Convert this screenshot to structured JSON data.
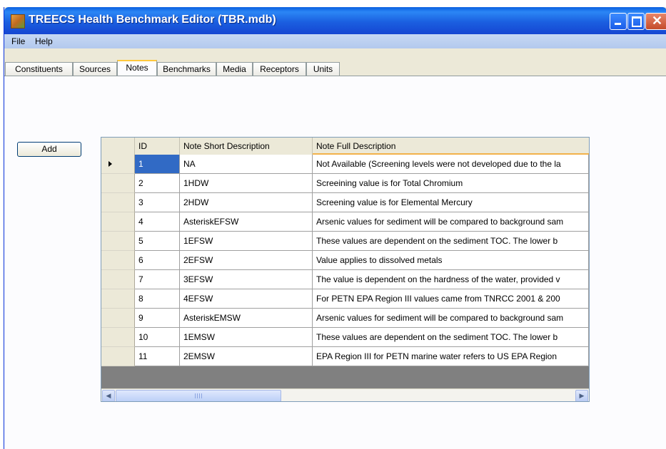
{
  "window": {
    "title": "TREECS Health Benchmark Editor (TBR.mdb)"
  },
  "menu": [
    "File",
    "Help"
  ],
  "tabs": [
    "Constituents",
    "Sources",
    "Notes",
    "Benchmarks",
    "Media",
    "Receptors",
    "Units"
  ],
  "active_tab": "Notes",
  "add_button": "Add",
  "grid": {
    "columns": [
      "ID",
      "Note Short Description",
      "Note Full Description"
    ],
    "rows": [
      {
        "id": "1",
        "short": "NA",
        "full": "Not Available (Screening levels were not developed due to the la"
      },
      {
        "id": "2",
        "short": "1HDW",
        "full": "Screeining value is for Total Chromium"
      },
      {
        "id": "3",
        "short": "2HDW",
        "full": "Screening value is for Elemental Mercury"
      },
      {
        "id": "4",
        "short": "AsteriskEFSW",
        "full": "Arsenic values for sediment will be compared to background sam"
      },
      {
        "id": "5",
        "short": "1EFSW",
        "full": "These values are dependent on the sediment TOC.  The lower b"
      },
      {
        "id": "6",
        "short": "2EFSW",
        "full": "Value applies to dissolved metals"
      },
      {
        "id": "7",
        "short": "3EFSW",
        "full": "The value is dependent on the hardness of the water, provided v"
      },
      {
        "id": "8",
        "short": "4EFSW",
        "full": "For PETN EPA Region III values came from TNRCC 2001 & 200"
      },
      {
        "id": "9",
        "short": "AsteriskEMSW",
        "full": "Arsenic values for sediment will be compared to background sam"
      },
      {
        "id": "10",
        "short": "1EMSW",
        "full": "These values are dependent on the sediment TOC.  The lower b"
      },
      {
        "id": "11",
        "short": "2EMSW",
        "full": "EPA Region III for PETN marine water refers to US EPA Region"
      }
    ],
    "selected_row": 0
  },
  "scrollbar": {
    "left_arrow": "◀",
    "right_arrow": "▶"
  }
}
